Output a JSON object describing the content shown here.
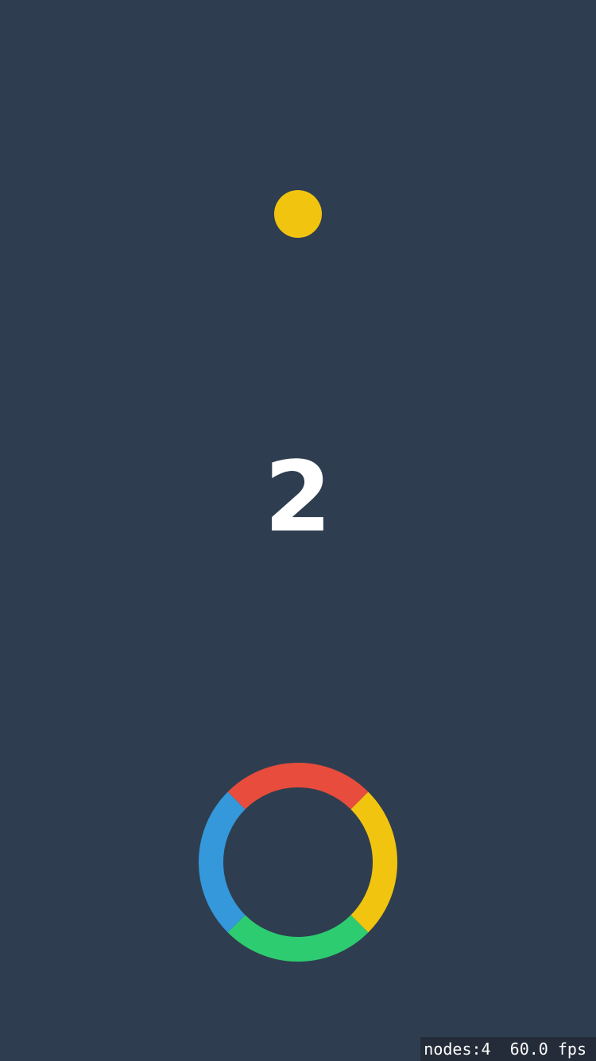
{
  "game": {
    "score": "2",
    "ball": {
      "color": "#f1c40f"
    },
    "ring": {
      "segments": [
        {
          "name": "red",
          "color": "#e74c3c"
        },
        {
          "name": "yellow",
          "color": "#f1c40f"
        },
        {
          "name": "green",
          "color": "#2ecc71"
        },
        {
          "name": "blue",
          "color": "#3498db"
        }
      ]
    },
    "background_color": "#2e3e50"
  },
  "debug": {
    "stats": "nodes:4  60.0 fps"
  }
}
